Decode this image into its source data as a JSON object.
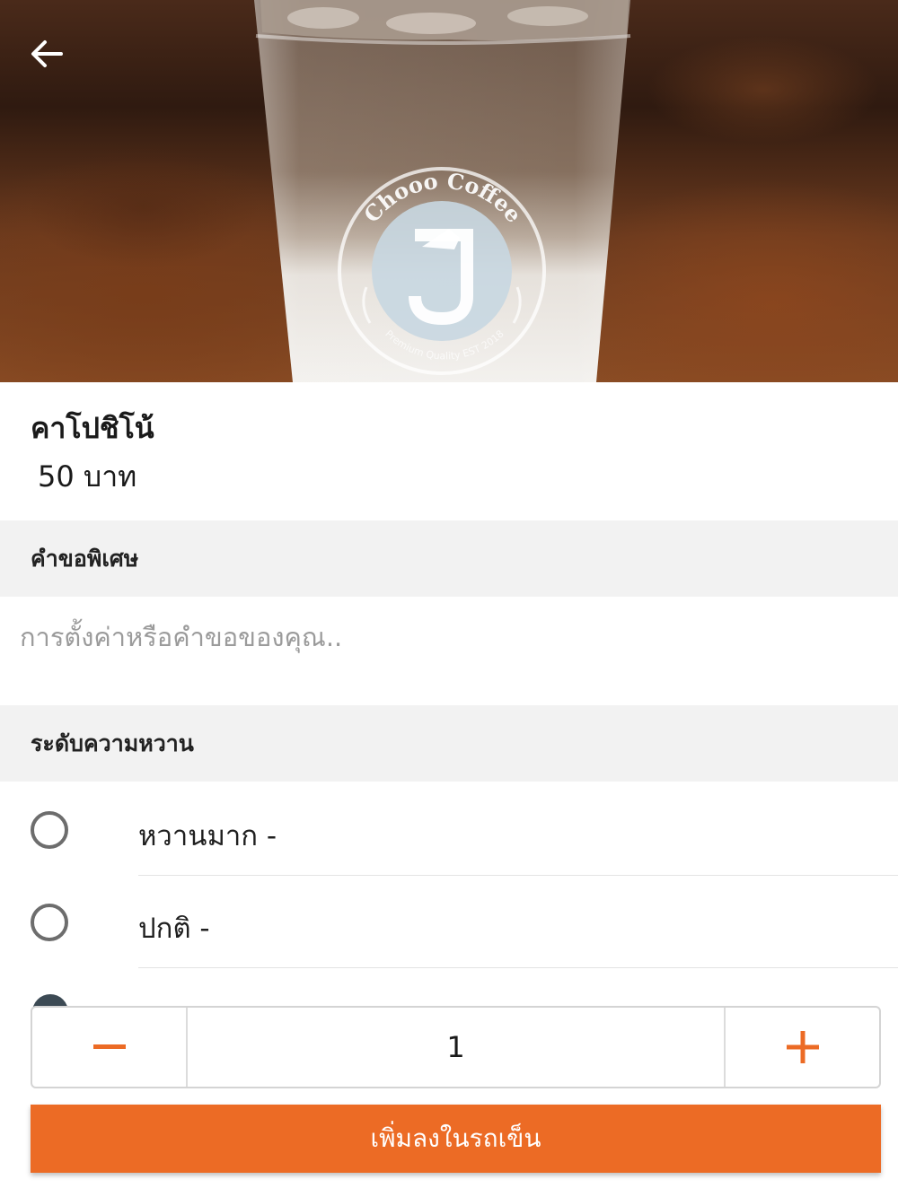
{
  "product": {
    "name": "คาโปชิโน้",
    "price": "50 บาท",
    "photo_brand_text": "Chooo Coffee",
    "photo_tagline": "Premium Quality EST 2018"
  },
  "special_request": {
    "header": "คำขอพิเศษ",
    "placeholder": "การตั้งค่าหรือคำขอของคุณ.."
  },
  "sweetness": {
    "header": "ระดับความหวาน",
    "options": [
      {
        "label": "หวานมาก  -"
      },
      {
        "label": "ปกติ  -"
      }
    ]
  },
  "quantity": {
    "value": "1"
  },
  "cart": {
    "add_label": "เพิ่มลงในรถเข็น"
  },
  "colors": {
    "accent": "#ec6b25",
    "section_bg": "#f2f2f2"
  }
}
